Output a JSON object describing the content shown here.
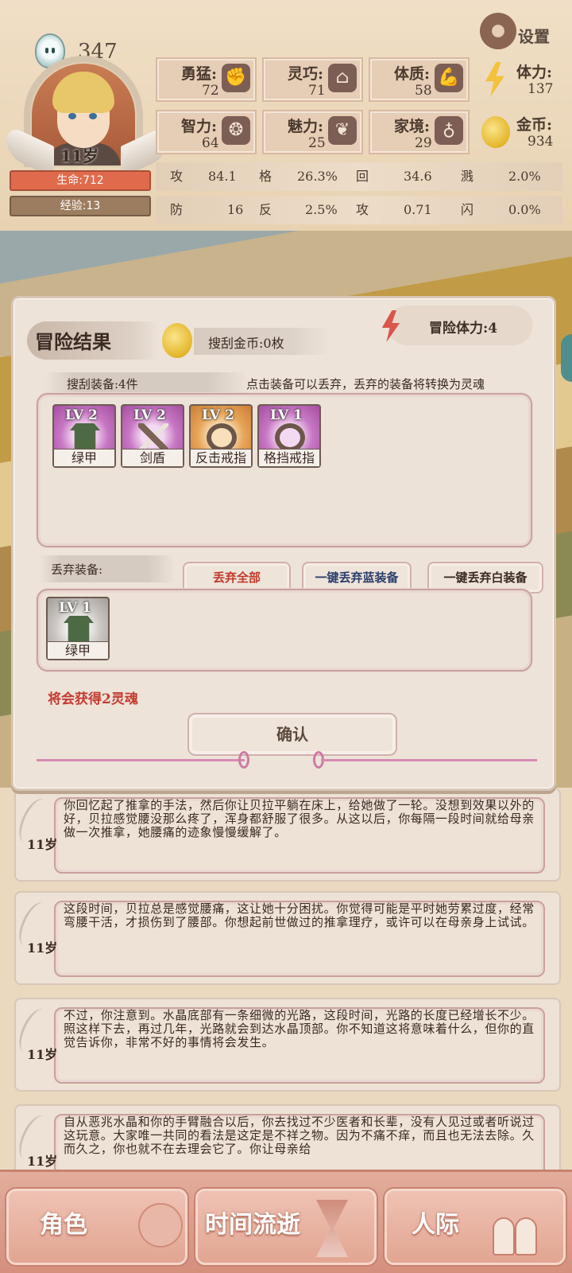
{
  "header": {
    "soul_count": "347",
    "age": "11岁",
    "hp": "生命:712",
    "xp": "经验:13",
    "settings": "设置",
    "attributes": [
      {
        "label": "勇猛:",
        "value": "72",
        "icon": "fist-icon"
      },
      {
        "label": "灵巧:",
        "value": "71",
        "icon": "cloak-icon"
      },
      {
        "label": "体质:",
        "value": "58",
        "icon": "arm-icon"
      },
      {
        "label": "智力:",
        "value": "64",
        "icon": "brain-icon"
      },
      {
        "label": "魅力:",
        "value": "25",
        "icon": "flower-icon"
      },
      {
        "label": "家境:",
        "value": "29",
        "icon": "money-bag-icon"
      }
    ],
    "stamina": {
      "label": "体力:",
      "value": "137"
    },
    "gold": {
      "label": "金币:",
      "value": "934"
    },
    "combat": [
      [
        {
          "label": "攻击:",
          "value": "84.1"
        },
        {
          "label": "格挡:",
          "value": "26.3%"
        },
        {
          "label": "回复:",
          "value": "34.6"
        },
        {
          "label": "溅伤:",
          "value": "2.0%"
        }
      ],
      [
        {
          "label": "防御:",
          "value": "16"
        },
        {
          "label": "反击:",
          "value": "2.5%"
        },
        {
          "label": "攻速:",
          "value": "0.71"
        },
        {
          "label": "闪避:",
          "value": "0.0%"
        }
      ]
    ]
  },
  "dialog": {
    "title": "冒险结果",
    "loot_gold": "搜刮金币:0枚",
    "stamina": "冒险体力:4",
    "loot_count": "搜刮装备:4件",
    "hint": "点击装备可以丢弃，丢弃的装备将转换为灵魂",
    "items": [
      {
        "lv": "LV 2",
        "name": "绿甲",
        "rarity": "purple",
        "icon": "armor-icon"
      },
      {
        "lv": "LV 2",
        "name": "剑盾",
        "rarity": "purple",
        "icon": "sword-shield-icon"
      },
      {
        "lv": "LV 2",
        "name": "反击戒指",
        "rarity": "orange",
        "icon": "ring-icon"
      },
      {
        "lv": "LV 1",
        "name": "格挡戒指",
        "rarity": "purple",
        "icon": "ring-icon"
      }
    ],
    "discard_label": "丢弃装备:",
    "btn_discard_all": "丢弃全部",
    "btn_discard_blue": "一键丢弃蓝装备",
    "btn_discard_white": "一键丢弃白装备",
    "discarded": [
      {
        "lv": "LV 1",
        "name": "绿甲",
        "rarity": "grey",
        "icon": "armor-icon"
      }
    ],
    "soul_gain": "将会获得2灵魂",
    "confirm": "确认"
  },
  "log": [
    {
      "age": "11岁",
      "text": "你回忆起了推拿的手法，然后你让贝拉平躺在床上，给她做了一轮。没想到效果以外的好，贝拉感觉腰没那么疼了，浑身都舒服了很多。从这以后，你每隔一段时间就给母亲做一次推拿，她腰痛的迹象慢慢缓解了。"
    },
    {
      "age": "11岁",
      "text": "这段时间，贝拉总是感觉腰痛，这让她十分困扰。你觉得可能是平时她劳累过度，经常弯腰干活，才损伤到了腰部。你想起前世做过的推拿理疗，或许可以在母亲身上试试。"
    },
    {
      "age": "11岁",
      "text": "不过，你注意到。水晶底部有一条细微的光路，这段时间，光路的长度已经增长不少。照这样下去，再过几年，光路就会到达水晶顶部。你不知道这将意味着什么，但你的直觉告诉你，非常不好的事情将会发生。"
    },
    {
      "age": "11岁",
      "text": "自从恶兆水晶和你的手臂融合以后，你去找过不少医者和长辈，没有人见过或者听说过这玩意。大家唯一共同的看法是这定是不祥之物。因为不痛不痒，而且也无法去除。久而久之，你也就不在去理会它了。你让母亲给"
    }
  ],
  "nav": [
    {
      "label": "角色",
      "icon": "role-icon"
    },
    {
      "label": "时间流逝",
      "icon": "hourglass-icon"
    },
    {
      "label": "人际",
      "icon": "people-icon"
    }
  ]
}
